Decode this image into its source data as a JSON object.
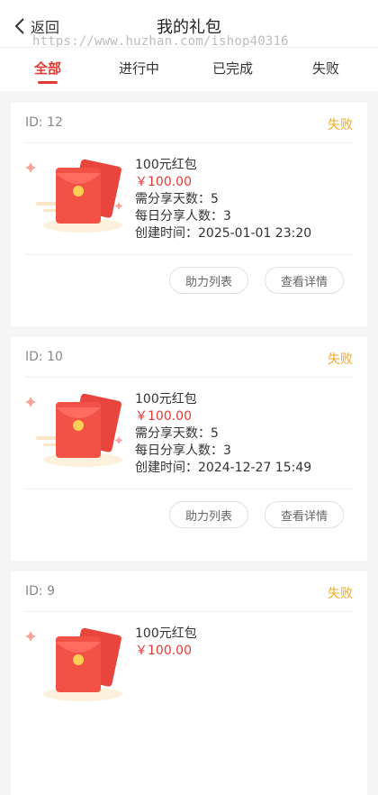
{
  "header": {
    "back_label": "返回",
    "title": "我的礼包",
    "watermark": "https://www.huzhan.com/ishop40316"
  },
  "tabs": [
    {
      "label": "全部",
      "active": true
    },
    {
      "label": "进行中",
      "active": false
    },
    {
      "label": "已完成",
      "active": false
    },
    {
      "label": "失败",
      "active": false
    }
  ],
  "labels": {
    "share_days": "需分享天数：",
    "daily_people": "每日分享人数：",
    "created_time": "创建时间："
  },
  "cards": [
    {
      "id": "ID: 12",
      "status": "失败",
      "name": "100元红包",
      "price": "￥100.00",
      "share_days": "5",
      "daily_people": "3",
      "created": "2025-01-01 23:20",
      "help_btn": "助力列表",
      "detail_btn": "查看详情"
    },
    {
      "id": "ID: 10",
      "status": "失败",
      "name": "100元红包",
      "price": "￥100.00",
      "share_days": "5",
      "daily_people": "3",
      "created": "2024-12-27 15:49",
      "help_btn": "助力列表",
      "detail_btn": "查看详情"
    },
    {
      "id": "ID: 9",
      "status": "失败",
      "name": "100元红包",
      "price": "￥100.00"
    }
  ],
  "colors": {
    "accent": "#e53935",
    "status_failed": "#f5a623"
  }
}
